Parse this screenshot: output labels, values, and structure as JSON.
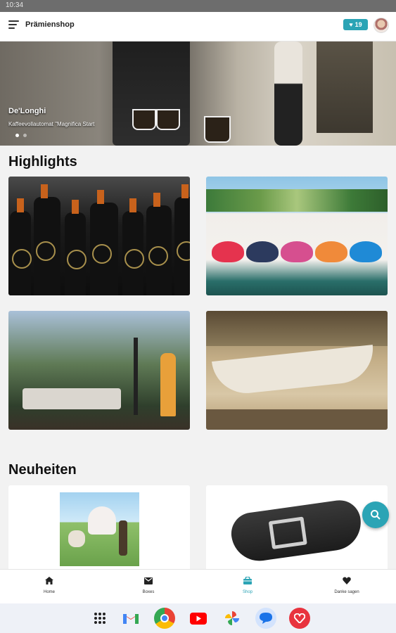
{
  "status_bar": {
    "time": "10:34"
  },
  "app_bar": {
    "title": "Prämienshop",
    "points": "19",
    "menu_icon": "menu-icon",
    "avatar_icon": "avatar"
  },
  "hero": {
    "title": "De'Longhi",
    "subtitle": "Kaffeevollautomat \"Magnifica Start",
    "slide_index": 1,
    "slide_count": 2
  },
  "highlights": {
    "title": "Highlights",
    "items": [
      {
        "image": "wine-bottles-image"
      },
      {
        "image": "beanbags-poolside-image"
      },
      {
        "image": "garden-party-heater-image"
      },
      {
        "image": "hammock-image"
      }
    ]
  },
  "neuheiten": {
    "title": "Neuheiten",
    "items": [
      {
        "image": "playmobil-horses-image"
      },
      {
        "image": "leather-belt-image"
      }
    ]
  },
  "fab": {
    "icon": "search-icon"
  },
  "bottom_nav": {
    "items": [
      {
        "label": "Home",
        "icon": "home-icon",
        "active": false
      },
      {
        "label": "Boxes",
        "icon": "inbox-icon",
        "active": false
      },
      {
        "label": "Shop",
        "icon": "shop-icon",
        "active": true
      },
      {
        "label": "Danke sagen",
        "icon": "heart-icon",
        "active": false
      }
    ]
  },
  "colors": {
    "accent": "#2ba4b5",
    "background": "#f2f2f2",
    "appbar": "#ffffff"
  },
  "dock": {
    "apps": [
      "apps-grid-icon",
      "gmail-icon",
      "chrome-icon",
      "youtube-icon",
      "photos-icon",
      "messages-icon",
      "heart-app-icon"
    ]
  }
}
